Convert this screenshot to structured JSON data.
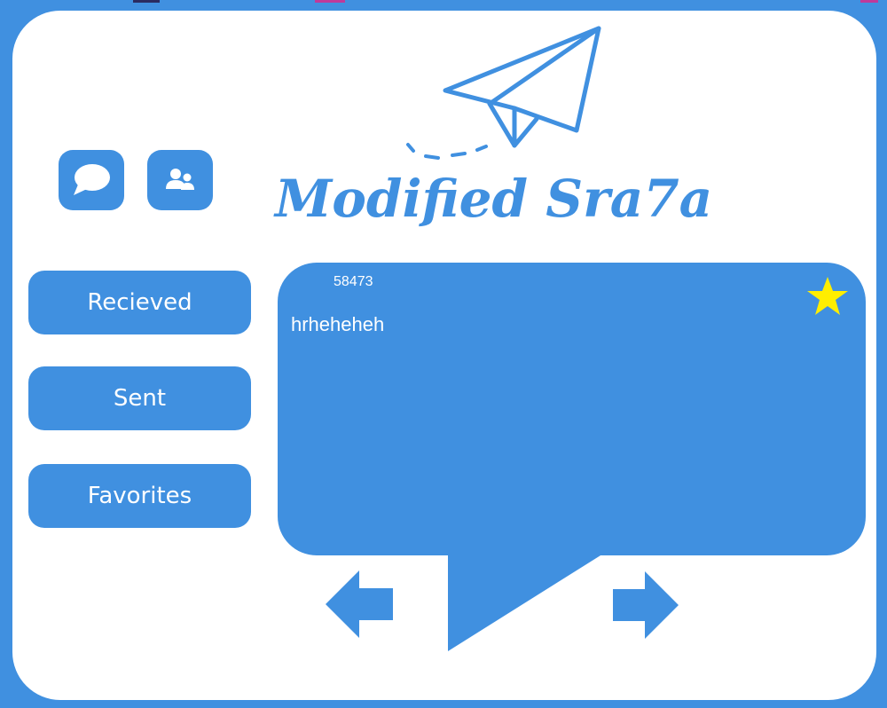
{
  "app": {
    "title": "Modified Sra7a"
  },
  "toolbar": {
    "messages_icon": "chat-bubble-icon",
    "contacts_icon": "users-icon"
  },
  "nav": {
    "received_label": "Recieved",
    "sent_label": "Sent",
    "favorites_label": "Favorites"
  },
  "message": {
    "id": "58473",
    "text": "hrheheheh",
    "favorite": true
  },
  "colors": {
    "primary": "#4090e0",
    "background": "#ffffff",
    "star": "#ffee00"
  }
}
